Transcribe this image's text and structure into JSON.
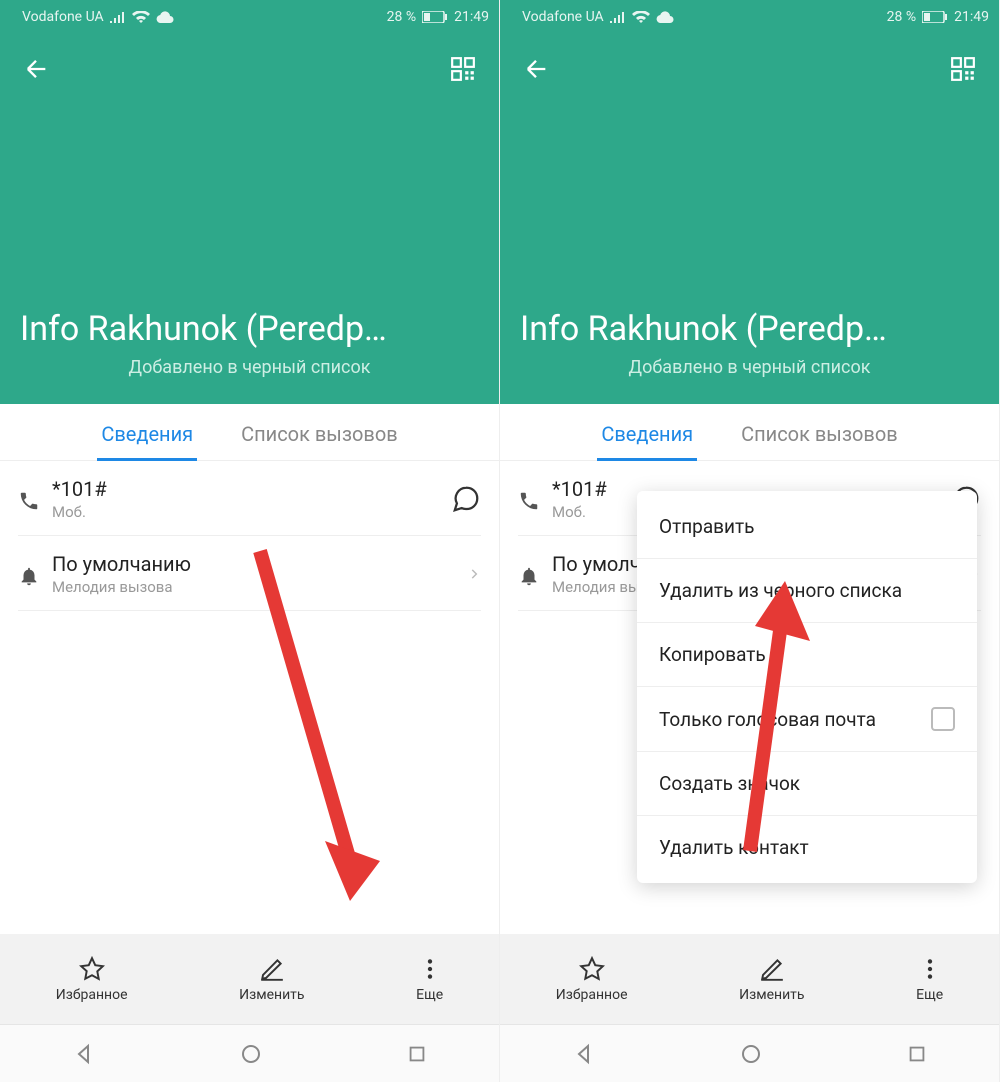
{
  "status": {
    "carrier": "Vodafone UA",
    "battery_pct": "28 %",
    "time": "21:49"
  },
  "header": {
    "contact_name": "Info Rakhunok (Peredp…",
    "sub": "Добавлено в черный список"
  },
  "tabs": {
    "details": "Сведения",
    "calls": "Список вызовов"
  },
  "rows": {
    "phone_number": "*101#",
    "phone_type": "Моб.",
    "ringtone_title": "По умолчанию",
    "ringtone_sub": "Мелодия вызова"
  },
  "actions": {
    "favorite": "Избранное",
    "edit": "Изменить",
    "more": "Еще"
  },
  "popup": {
    "send": "Отправить",
    "remove_blacklist": "Удалить из черного списка",
    "copy": "Копировать",
    "voicemail_only": "Только голосовая почта",
    "create_icon": "Создать значок",
    "delete_contact": "Удалить контакт"
  }
}
